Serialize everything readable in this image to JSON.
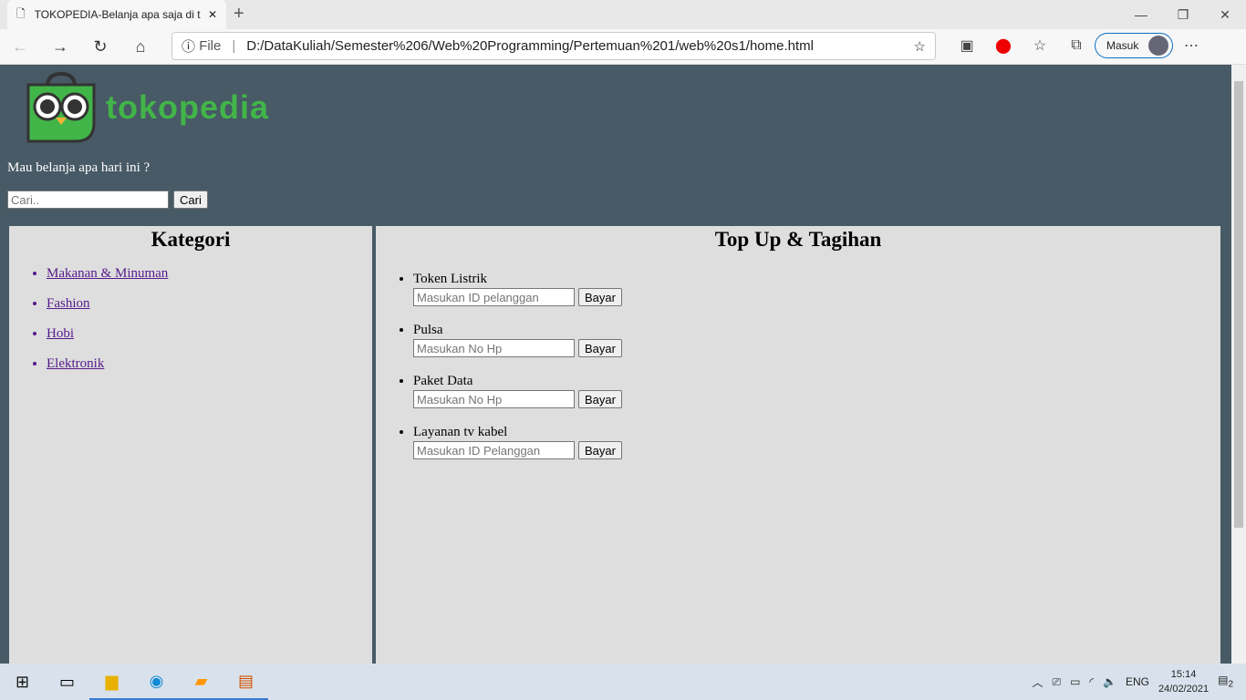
{
  "browser": {
    "tab_title": "TOKOPEDIA-Belanja apa saja di t",
    "address_prefix": "File",
    "url": "D:/DataKuliah/Semester%206/Web%20Programming/Pertemuan%201/web%20s1/home.html",
    "signin_label": "Masuk"
  },
  "header": {
    "logo_text": "tokopedia",
    "tagline": "Mau belanja apa hari ini ?",
    "search_placeholder": "Cari..",
    "search_button": "Cari"
  },
  "kategori": {
    "title": "Kategori",
    "items": [
      "Makanan & Minuman",
      "Fashion",
      "Hobi",
      "Elektronik"
    ]
  },
  "topup": {
    "title": "Top Up & Tagihan",
    "items": [
      {
        "label": "Token Listrik",
        "placeholder": "Masukan ID pelanggan",
        "button": "Bayar"
      },
      {
        "label": "Pulsa",
        "placeholder": "Masukan No Hp",
        "button": "Bayar"
      },
      {
        "label": "Paket Data",
        "placeholder": "Masukan No Hp",
        "button": "Bayar"
      },
      {
        "label": "Layanan tv kabel",
        "placeholder": "Masukan ID Pelanggan",
        "button": "Bayar"
      }
    ]
  },
  "taskbar": {
    "lang": "ENG",
    "time": "15:14",
    "date": "24/02/2021",
    "notifications": "2"
  }
}
